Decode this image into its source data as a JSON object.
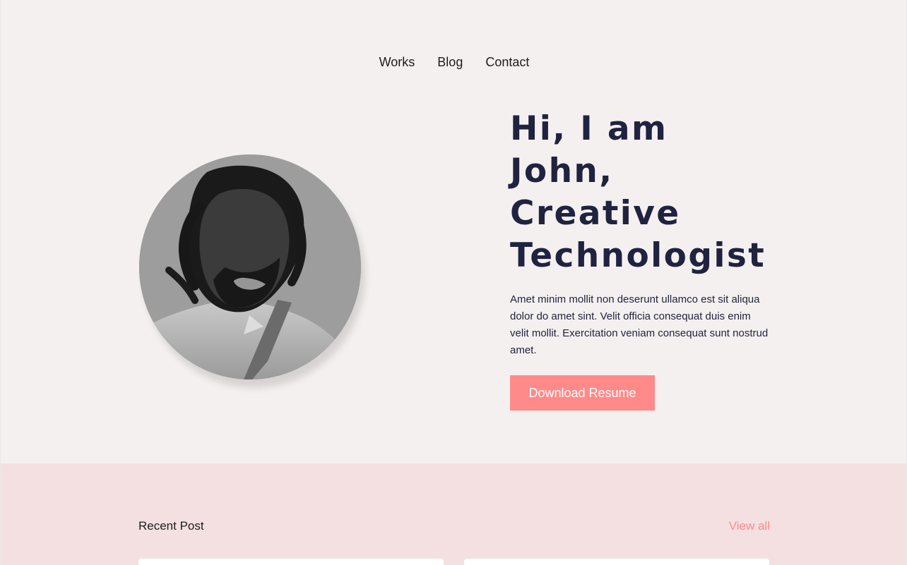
{
  "nav": {
    "items": [
      {
        "label": "Works"
      },
      {
        "label": "Blog"
      },
      {
        "label": "Contact"
      }
    ]
  },
  "hero": {
    "title_lines": [
      "Hi, I am",
      "John,",
      "Creative",
      "Technologist"
    ],
    "description": "Amet minim mollit non deserunt ullamco est sit aliqua dolor do amet sint. Velit officia consequat duis enim velit mollit. Exercitation veniam consequat sunt nostrud amet.",
    "cta_label": "Download Resume"
  },
  "recent": {
    "title": "Recent Post",
    "view_all_label": "View all"
  },
  "colors": {
    "accent": "#ff8a89",
    "heading": "#1f2340",
    "hero_bg": "#f5f0f0",
    "recent_bg": "#f4e0e1"
  }
}
